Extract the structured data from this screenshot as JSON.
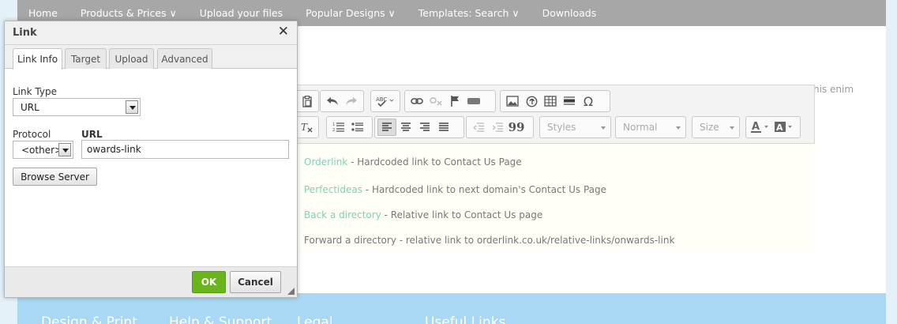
{
  "nav": {
    "items": [
      "Home",
      "Products & Prices ∨",
      "Upload your files",
      "Popular Designs ∨",
      "Templates: Search ∨",
      "Downloads"
    ]
  },
  "background": {
    "snippet": "his enim"
  },
  "editor": {
    "toolbar": {
      "icons_row1": [
        "paste-icon",
        "undo-icon",
        "redo-icon",
        "spellcheck-icon",
        "link-icon",
        "unlink-icon",
        "anchor-icon",
        "iframe-icon",
        "image-icon",
        "flash-icon",
        "table-icon",
        "horizontal-rule-icon",
        "special-char-icon"
      ],
      "icons_row2": [
        "remove-format-icon",
        "numbered-list-icon",
        "bullet-list-icon",
        "align-left-icon",
        "align-center-icon",
        "align-right-icon",
        "justify-icon",
        "outdent-icon",
        "indent-icon",
        "blockquote-icon",
        "text-color-icon",
        "background-color-icon"
      ],
      "styles_label": "Styles",
      "format_label": "Normal",
      "size_label": "Size",
      "special_char": "Ω",
      "quote_char": "99"
    },
    "lines": [
      {
        "link": "Orderlink",
        "rest": " - Hardcoded link to Contact Us Page"
      },
      {
        "link": "Perfectideas",
        "rest": " - Hardcoded link to next domain's Contact Us Page"
      },
      {
        "link": "Back a directory",
        "rest": " - Relative link to Contact Us page"
      },
      {
        "link": "",
        "rest": "Forward a directory - relative link to orderlink.co.uk/relative-links/onwards-link"
      }
    ]
  },
  "dialog": {
    "title": "Link",
    "close_symbol": "✕",
    "tabs": [
      "Link Info",
      "Target",
      "Upload",
      "Advanced"
    ],
    "link_type_label": "Link Type",
    "link_type_value": "URL",
    "protocol_label": "Protocol",
    "protocol_value": "<other>",
    "url_label": "URL",
    "url_value": "owards-link",
    "browse_label": "Browse Server",
    "ok_label": "OK",
    "cancel_label": "Cancel"
  },
  "footer": {
    "headings": [
      "Design & Print",
      "Help & Support",
      "Legal",
      "Useful Links"
    ]
  },
  "colors": {
    "nav_bg": "#a7a7a7",
    "footer_bg": "#a8d8f3",
    "link_color": "#7fd0b8",
    "ok_green": "#6ab41c"
  }
}
